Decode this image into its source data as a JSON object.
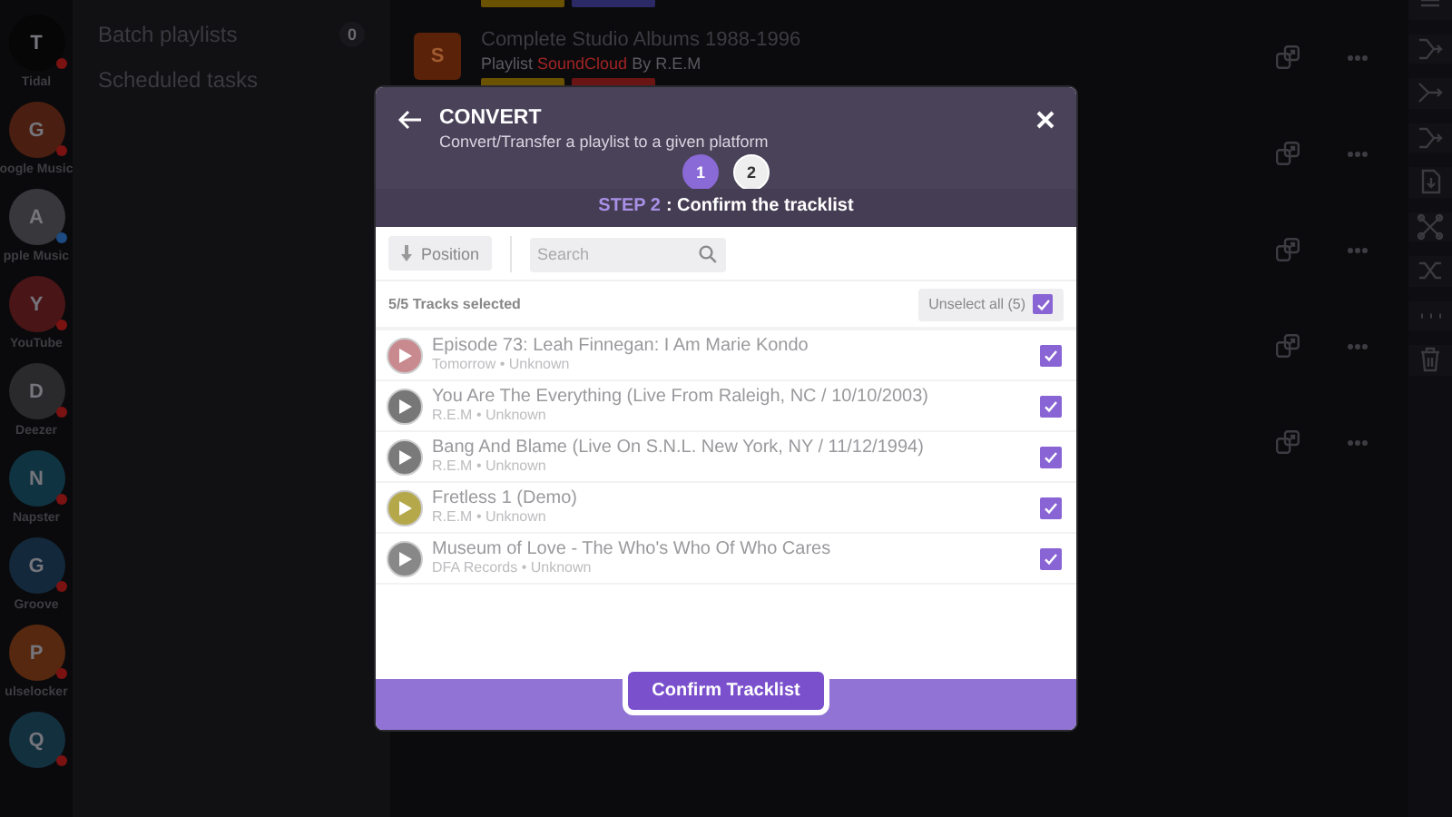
{
  "services": [
    {
      "initial": "T",
      "name": "Tidal",
      "color": "#060606",
      "error": true
    },
    {
      "initial": "G",
      "name": "oogle Music",
      "color": "#4a1e10",
      "error": true
    },
    {
      "initial": "A",
      "name": "pple Music",
      "color": "#38383c",
      "error": false
    },
    {
      "initial": "Y",
      "name": "YouTube",
      "color": "#4a1517",
      "error": true
    },
    {
      "initial": "D",
      "name": "Deezer",
      "color": "#2a2a2d",
      "error": true
    },
    {
      "initial": "N",
      "name": "Napster",
      "color": "#0f3340",
      "error": true
    },
    {
      "initial": "G",
      "name": "Groove",
      "color": "#13283a",
      "error": true
    },
    {
      "initial": "P",
      "name": "ulselocker",
      "color": "#56280f",
      "error": true
    },
    {
      "initial": "Q",
      "color": "#13303f",
      "error": true
    }
  ],
  "sidebar": {
    "items": [
      {
        "label": "Batch playlists",
        "count": "0"
      },
      {
        "label": "Scheduled tasks"
      }
    ]
  },
  "playlists": [
    {
      "tags": [
        {
          "color": "#6b5200"
        },
        {
          "color": "#2b2a66"
        }
      ]
    },
    {
      "initial": "S",
      "color": "#5a2208",
      "title": "Complete Studio Albums 1988-1996",
      "type": "Playlist",
      "source": "SoundCloud",
      "author": "By R.E.M",
      "tags": [
        {
          "color": "#6b5200"
        },
        {
          "color": "#6b1414"
        }
      ],
      "actions": [
        {
          "kind": "share"
        },
        {
          "kind": "more"
        }
      ]
    },
    {
      "actions": [
        {
          "kind": "share"
        },
        {
          "kind": "more"
        }
      ]
    },
    {
      "actions": [
        {
          "kind": "share"
        },
        {
          "kind": "more"
        }
      ]
    },
    {
      "actions": [
        {
          "kind": "share"
        },
        {
          "kind": "more"
        }
      ]
    },
    {
      "actions": [
        {
          "kind": "share"
        },
        {
          "kind": "more"
        }
      ]
    }
  ],
  "tools": [
    {
      "kind": "list"
    },
    {
      "kind": "merge"
    },
    {
      "kind": "split"
    },
    {
      "kind": "merge"
    },
    {
      "kind": "file"
    },
    {
      "kind": "cross"
    },
    {
      "kind": "shuffle"
    },
    {
      "kind": "more"
    },
    {
      "kind": "trash"
    }
  ],
  "modal": {
    "title": "CONVERT",
    "subtitle": "Convert/Transfer a playlist to a given platform",
    "steps": [
      {
        "label": "1",
        "done": true
      },
      {
        "label": "2",
        "done": false
      }
    ],
    "step_label": "STEP 2",
    "step_text": ": Confirm the tracklist",
    "sort_button": "Position",
    "search": {
      "placeholder": "Search"
    },
    "selected_count": "5/5 Tracks selected",
    "unselect_all": {
      "label": "Unselect all (5)",
      "checked": true
    },
    "tracks": [
      {
        "title": "Episode 73: Leah Finnegan: I Am Marie Kondo",
        "meta": "Tomorrow • Unknown",
        "color": "#c98a8f",
        "checked": true
      },
      {
        "title": "You Are The Everything (Live From Raleigh, NC / 10/10/2003)",
        "meta": "R.E.M • Unknown",
        "color": "#777777",
        "checked": true
      },
      {
        "title": "Bang And Blame (Live On S.N.L. New York, NY / 11/12/1994)",
        "meta": "R.E.M • Unknown",
        "color": "#7a7a7a",
        "checked": true
      },
      {
        "title": "Fretless 1 (Demo)",
        "meta": "R.E.M • Unknown",
        "color": "#b5a84a",
        "checked": true
      },
      {
        "title": "Museum of Love - The Who's Who Of Who Cares",
        "meta": "DFA Records • Unknown",
        "color": "#888888",
        "checked": true
      }
    ],
    "confirm_button": "Confirm Tracklist"
  }
}
